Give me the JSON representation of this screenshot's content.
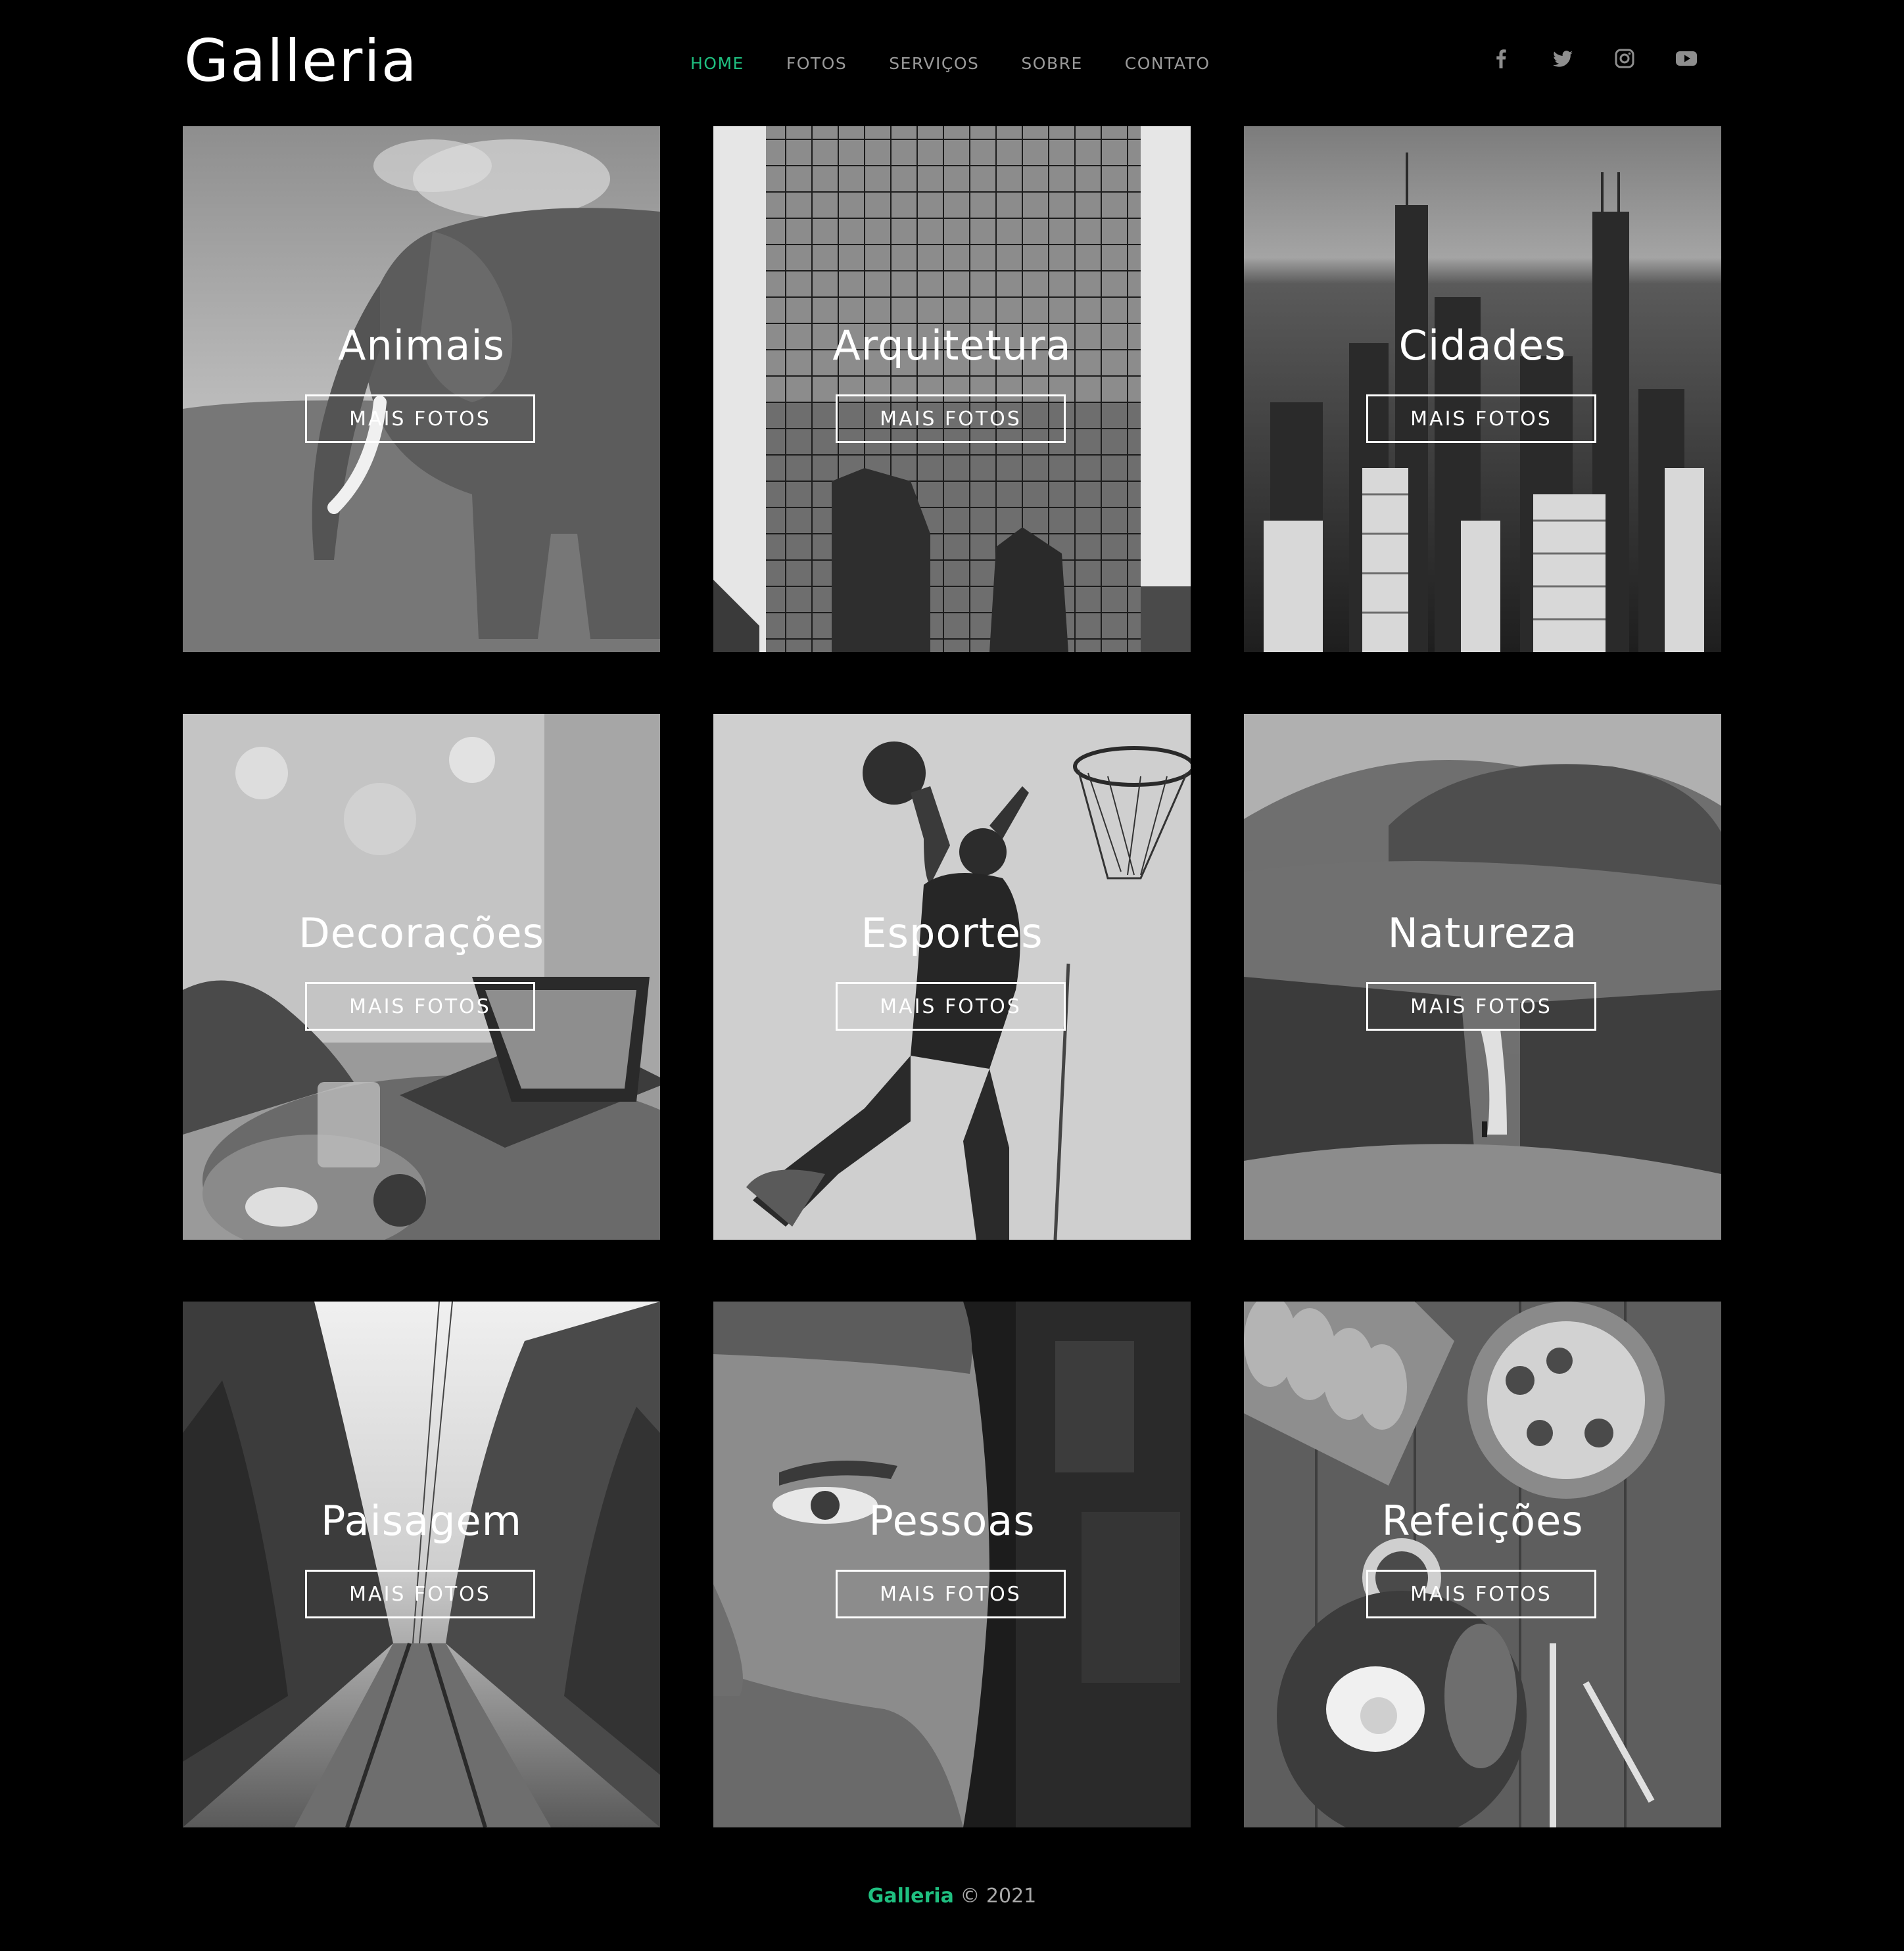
{
  "header": {
    "logo": "Galleria",
    "nav": [
      {
        "label": "HOME",
        "active": true
      },
      {
        "label": "FOTOS",
        "active": false
      },
      {
        "label": "SERVIÇOS",
        "active": false
      },
      {
        "label": "SOBRE",
        "active": false
      },
      {
        "label": "CONTATO",
        "active": false
      }
    ],
    "social_icons": [
      "facebook-icon",
      "twitter-icon",
      "instagram-icon",
      "youtube-icon"
    ]
  },
  "gallery": {
    "button_label": "MAIS FOTOS",
    "cards": [
      {
        "title": "Animais",
        "image": "elephant in tall grass"
      },
      {
        "title": "Arquitetura",
        "image": "glass skyscraper facade"
      },
      {
        "title": "Cidades",
        "image": "city skyline at dusk"
      },
      {
        "title": "Decorações",
        "image": "laptop and coffee on cafe table"
      },
      {
        "title": "Esportes",
        "image": "basketball player dunking"
      },
      {
        "title": "Natureza",
        "image": "waterfall over sea cliffs"
      },
      {
        "title": "Paisagem",
        "image": "railway track through forest"
      },
      {
        "title": "Pessoas",
        "image": "close-up portrait of a man"
      },
      {
        "title": "Refeições",
        "image": "breakfast table with eggs and bread"
      }
    ]
  },
  "footer": {
    "brand": "Galleria",
    "copyright": "© 2021"
  },
  "colors": {
    "background": "#000000",
    "accent": "#1fbf80",
    "nav_text": "#9a9a9a",
    "text": "#ffffff"
  }
}
